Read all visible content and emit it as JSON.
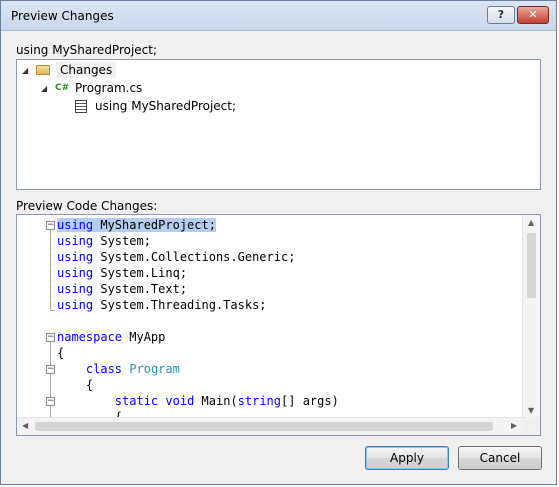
{
  "window": {
    "title": "Preview Changes",
    "help_label": "?",
    "close_label": "✕"
  },
  "header_label": "using MySharedProject;",
  "tree": {
    "items": [
      {
        "label": "Changes",
        "icon": "folder-icon",
        "expanded": true
      },
      {
        "label": "Program.cs",
        "icon": "csharp-file-icon",
        "expanded": true
      },
      {
        "label": "using MySharedProject;",
        "icon": "using-directive-icon"
      }
    ],
    "file_icon_text": "C#"
  },
  "code_label": "Preview Code Changes:",
  "code": {
    "lines": [
      "using MySharedProject;",
      "using System;",
      "using System.Collections.Generic;",
      "using System.Linq;",
      "using System.Text;",
      "using System.Threading.Tasks;",
      "",
      "namespace MyApp",
      "{",
      "    class Program",
      "    {",
      "        static void Main(string[] args)",
      "        {"
    ],
    "highlighted_line": 0
  },
  "buttons": {
    "apply": "Apply",
    "cancel": "Cancel"
  },
  "colors": {
    "keyword": "#0000ff",
    "type": "#2b91af",
    "selection": "#b6cdf2"
  }
}
